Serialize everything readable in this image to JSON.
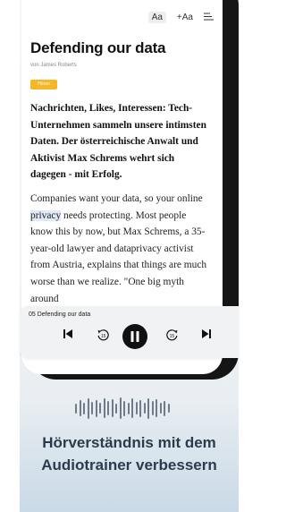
{
  "toolbar": {
    "font_size_label": "Aa",
    "increase_font_label": "+Aa",
    "list_icon": "list-icon"
  },
  "article": {
    "title": "Defending our data",
    "author": "von James Roberts",
    "tag": "Hören",
    "lead": "Nachrichten, Likes, Interessen: Tech-Unternehmen sammeln unsere intimsten Daten. Der österreichische Anwalt und Aktivist Max Schrems wehrt sich dagegen - mit Erfolg.",
    "body_before": "Companies want your data, so your online ",
    "body_highlight": "privacy",
    "body_after": " needs protecting. Most people know this by now, but Max Schrems, a 35-year-old lawyer and dataprivacy activist from Austria, explains that things are much worse than we realize. \"One big myth around"
  },
  "player": {
    "track_title": "05 Defending our data",
    "icons": [
      "skip-back-icon",
      "rewind-15-icon",
      "pause-icon",
      "forward-15-icon",
      "skip-forward-icon"
    ]
  },
  "promo": {
    "waveform_levels": [
      0.45,
      0.75,
      0.55,
      0.95,
      0.6,
      0.8,
      0.5,
      0.9,
      0.65,
      0.85,
      0.45,
      1.0,
      0.7,
      0.55,
      0.9,
      0.6,
      0.8,
      0.5,
      0.95,
      0.65,
      0.85,
      0.5,
      0.7,
      0.4
    ],
    "headline_line1": "Hörverständnis mit dem",
    "headline_line2": "Audiotrainer verbessern"
  }
}
